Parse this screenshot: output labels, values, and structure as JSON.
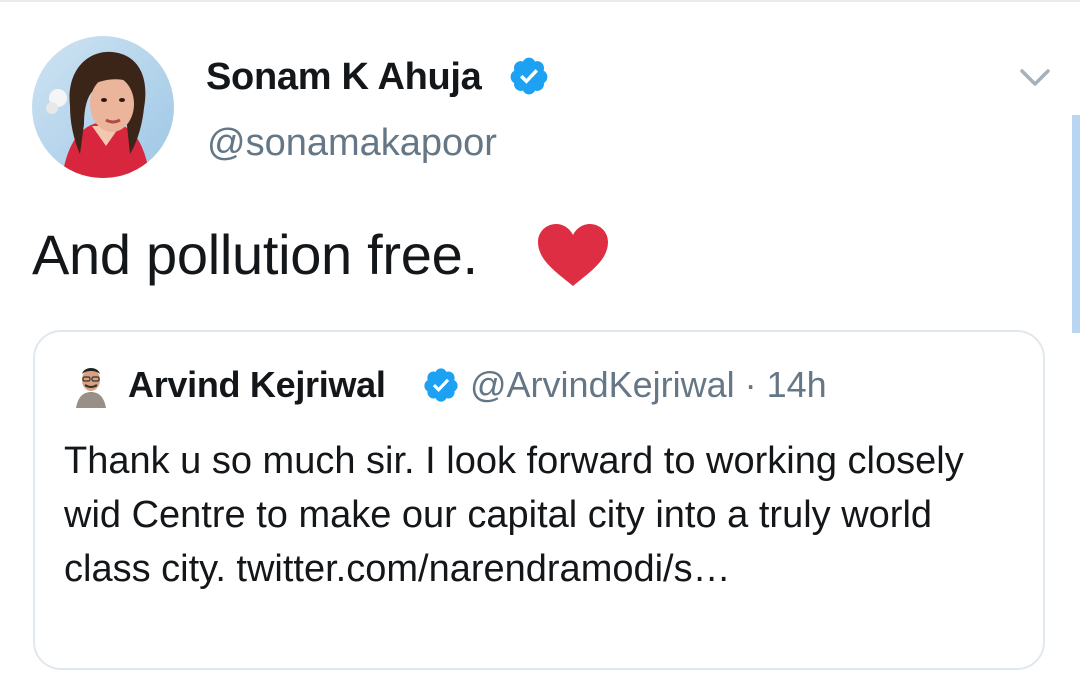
{
  "tweet": {
    "author": {
      "display_name": "Sonam K Ahuja",
      "handle": "@sonamakapoor",
      "verified": true
    },
    "text": "And pollution free.",
    "emoji": "red-heart"
  },
  "quoted_tweet": {
    "author": {
      "display_name": "Arvind Kejriwal",
      "handle": "@ArvindKejriwal",
      "verified": true
    },
    "meta": "@ArvindKejriwal · 14h",
    "text": "Thank u so much sir. I look forward to working closely wid Centre to make our capital city into a truly world class city. twitter.com/narendramodi/s…"
  },
  "icons": {
    "verified": "verified-badge-icon",
    "menu": "chevron-down-icon",
    "heart": "heart-icon"
  },
  "colors": {
    "verified_blue": "#1da1f2",
    "secondary_text": "#657786",
    "heart_red": "#e0245e",
    "card_border": "#e1e8ed"
  }
}
